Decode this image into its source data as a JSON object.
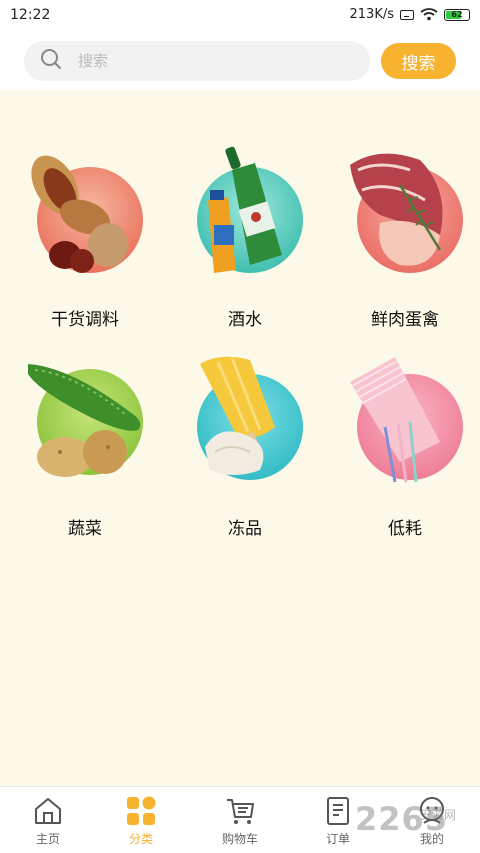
{
  "status_bar": {
    "time": "12:22",
    "speed": "213K/s",
    "battery": "62",
    "battery_color": "#2ecc40"
  },
  "search": {
    "placeholder": "搜索",
    "button_label": "搜索",
    "accent_color": "#f7b230"
  },
  "categories": [
    {
      "label": "干货调料",
      "image": "peanuts-dates-image"
    },
    {
      "label": "酒水",
      "image": "beer-drinks-image"
    },
    {
      "label": "鲜肉蛋禽",
      "image": "raw-meat-image"
    },
    {
      "label": "蔬菜",
      "image": "cucumber-potato-image"
    },
    {
      "label": "冻品",
      "image": "popsicle-dumplings-image"
    },
    {
      "label": "低耗",
      "image": "paper-cups-straws-image"
    }
  ],
  "bottom_nav": {
    "items": [
      {
        "label": "主页",
        "icon": "home-icon"
      },
      {
        "label": "分类",
        "icon": "category-icon",
        "active": true
      },
      {
        "label": "购物车",
        "icon": "cart-icon"
      },
      {
        "label": "订单",
        "icon": "order-icon"
      },
      {
        "label": "我的",
        "icon": "profile-icon"
      }
    ]
  },
  "watermark": {
    "text": "2265",
    "sub": "安游网"
  }
}
